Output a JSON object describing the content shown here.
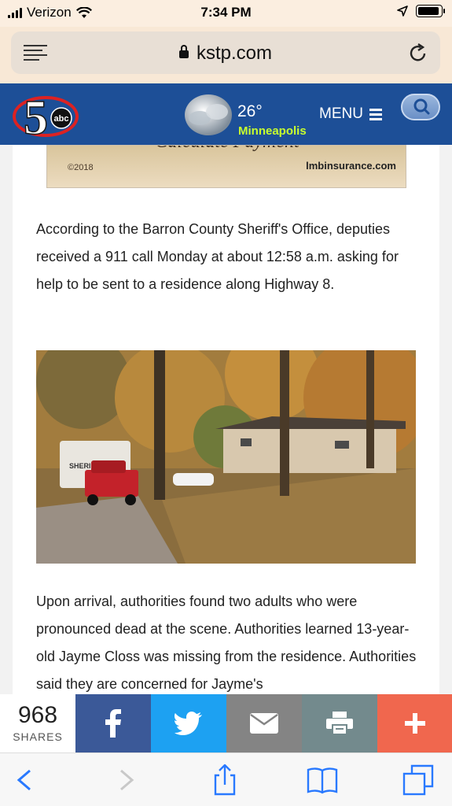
{
  "status": {
    "carrier": "Verizon",
    "time": "7:34 PM"
  },
  "browser": {
    "host": "kstp.com"
  },
  "site": {
    "logo_text": "5",
    "logo_badge": "abc",
    "temperature": "26°",
    "city": "Minneapolis",
    "menu_label": "MENU"
  },
  "ad": {
    "copyright": "©2018",
    "domain": "lmbinsurance.com",
    "headline": "Calculate Payment"
  },
  "article": {
    "para1": "According to the Barron County Sheriff's Office, deputies received a 911 call Monday at about 12:58 a.m. asking for help to be sent to a residence along Highway 8.",
    "photo_truck_text": "SHERIFF",
    "para2": "Upon arrival, authorities found two adults who were pronounced dead at the scene. Authorities learned 13-year-old Jayme Closs was missing from the residence. Authorities said they are concerned for Jayme's"
  },
  "share": {
    "count": "968",
    "label": "SHARES",
    "colors": {
      "facebook": "#3b5998",
      "twitter": "#1da1f2",
      "email": "#848484",
      "print": "#738a8d",
      "more": "#f0674e"
    }
  },
  "icons": [
    "wifi-icon",
    "location-arrow-icon",
    "battery-icon",
    "reader-menu-icon",
    "lock-icon",
    "reload-icon",
    "weather-icon",
    "hamburger-icon",
    "search-icon",
    "facebook-icon",
    "twitter-icon",
    "email-icon",
    "print-icon",
    "plus-icon",
    "back-icon",
    "forward-icon",
    "share-icon",
    "bookmarks-icon",
    "tabs-icon"
  ]
}
